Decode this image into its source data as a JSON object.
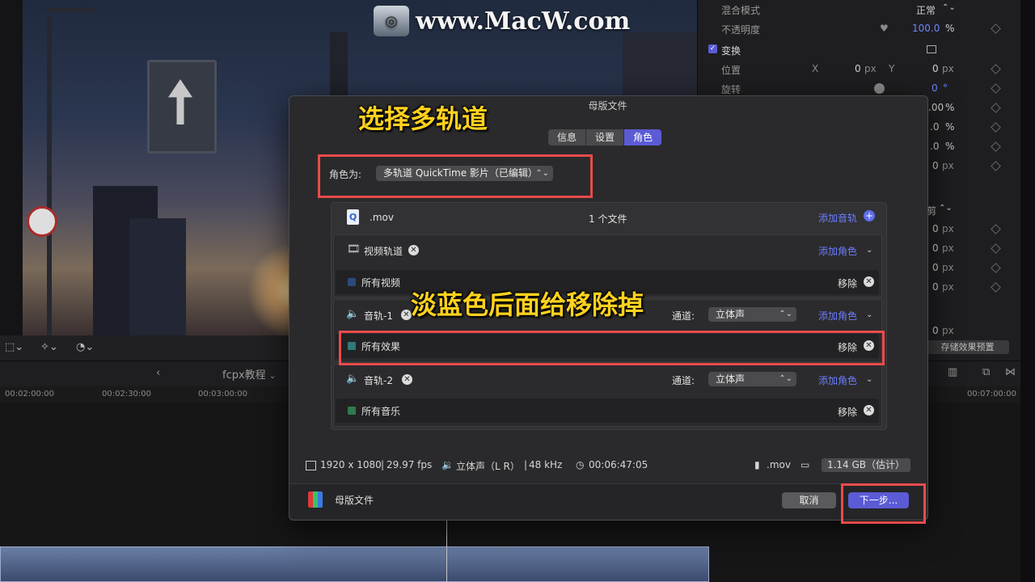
{
  "watermark": {
    "text": "www.MacW.com"
  },
  "inspector": {
    "blend_mode_label": "混合模式",
    "blend_mode_value": "正常",
    "opacity_label": "不透明度",
    "opacity_value": "100.0",
    "percent": "%",
    "transform_label": "变换",
    "position_label": "位置",
    "position_x_label": "X",
    "position_x": "0",
    "position_y_label": "Y",
    "position_y": "0",
    "px": "px",
    "rotation_label": "旋转",
    "rotation_value": "0",
    "degree": "°",
    "scale_rows": [
      ".00",
      ".0",
      ".0"
    ],
    "extra_px_rows": [
      "0",
      "0",
      "0",
      "0",
      "0"
    ],
    "crop_label": "剪",
    "extra_bottom_px": "0",
    "save_preset": "存储效果预置"
  },
  "timeline": {
    "project_title": "fcpx教程",
    "ticks": [
      "00:02:00:00",
      "00:02:30:00",
      "00:03:00:00",
      "00:07:00:00"
    ]
  },
  "dialog": {
    "title": "母版文件",
    "tabs": [
      {
        "label": "信息",
        "active": false
      },
      {
        "label": "设置",
        "active": false
      },
      {
        "label": "角色",
        "active": true
      }
    ],
    "role_label": "角色为:",
    "role_value": "多轨道 QuickTime 影片（已编辑）",
    "file": {
      "name": ".mov",
      "count": "1 个文件",
      "add_track": "添加音轨"
    },
    "video_track": {
      "label": "视频轨道",
      "add_role": "添加角色",
      "item": "所有视频",
      "remove": "移除",
      "swatch": "#2c4a7a"
    },
    "audio1": {
      "label": "音轨-1",
      "channel_label": "通道:",
      "channel_value": "立体声",
      "add_role": "添加角色",
      "item": "所有效果",
      "remove": "移除",
      "swatch": "#2f7a7a"
    },
    "audio2": {
      "label": "音轨-2",
      "channel_label": "通道:",
      "channel_value": "立体声",
      "add_role": "添加角色",
      "item": "所有音乐",
      "remove": "移除",
      "swatch": "#2f7a4a"
    },
    "info": {
      "resolution": "1920 x 1080",
      "fps": "29.97 fps",
      "audio": "立体声（L R）",
      "rate": "48 kHz",
      "duration": "00:06:47:05",
      "ext": ".mov",
      "size": "1.14 GB（估计）"
    },
    "footer_label": "母版文件",
    "cancel": "取消",
    "next": "下一步..."
  },
  "annotations": {
    "caption_top": "选择多轨道",
    "caption_mid": "淡蓝色后面给移除掉"
  },
  "colors": {
    "accent": "#5b5bd6",
    "link": "#6c7cff",
    "annotation_red": "#ea4b4b",
    "caption_yellow": "#ffd21e"
  }
}
